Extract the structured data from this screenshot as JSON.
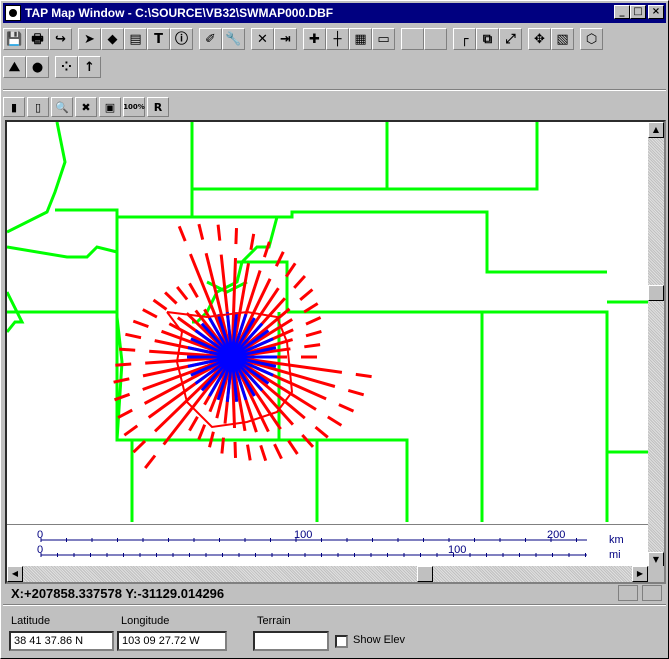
{
  "window": {
    "title": "TAP Map Window - C:\\SOURCE\\VB32\\SWMAP000.DBF",
    "minimize": "_",
    "maximize": "□",
    "close": "×"
  },
  "toolbar1": [
    {
      "name": "save-icon",
      "glyph": "💾"
    },
    {
      "name": "print-icon",
      "glyph": "🖶"
    },
    {
      "name": "redo-icon",
      "glyph": "↪"
    },
    {
      "name": "pointer-icon",
      "glyph": "➤"
    },
    {
      "name": "select-region-icon",
      "glyph": "◆"
    },
    {
      "name": "layer-icon",
      "glyph": "▤"
    },
    {
      "name": "text-icon",
      "glyph": "T"
    },
    {
      "name": "info-icon",
      "glyph": "ⓘ"
    },
    {
      "name": "draw-line-icon",
      "glyph": "✐"
    },
    {
      "name": "wrench-icon",
      "glyph": "🔧"
    },
    {
      "name": "delete-icon",
      "glyph": "✕"
    },
    {
      "name": "exit-icon",
      "glyph": "⇥"
    },
    {
      "name": "add-point-icon",
      "glyph": "✚"
    },
    {
      "name": "ruler-icon",
      "glyph": "┼"
    },
    {
      "name": "grid-icon",
      "glyph": "▦"
    },
    {
      "name": "document-icon",
      "glyph": "▭"
    },
    {
      "name": "blank-button-1",
      "glyph": ""
    },
    {
      "name": "blank-button-2",
      "glyph": ""
    },
    {
      "name": "corner-icon",
      "glyph": "┌"
    },
    {
      "name": "zoom-box-icon",
      "glyph": "⧉"
    },
    {
      "name": "expand-icon",
      "glyph": "⤢"
    },
    {
      "name": "pan-icon",
      "glyph": "✥"
    },
    {
      "name": "colors-icon",
      "glyph": "▧"
    },
    {
      "name": "polygon-icon",
      "glyph": "⬡"
    }
  ],
  "toolbar2": [
    {
      "name": "terrain-profile-icon",
      "glyph": "⛰"
    },
    {
      "name": "globe-icon",
      "glyph": "●"
    },
    {
      "name": "points-icon",
      "glyph": "⁘"
    },
    {
      "name": "arrow-up-icon",
      "glyph": "↑"
    }
  ],
  "toolbar3": [
    {
      "name": "map-icon",
      "glyph": "▮"
    },
    {
      "name": "small-map-icon",
      "glyph": "▯"
    },
    {
      "name": "zoom-icon",
      "glyph": "🔍"
    },
    {
      "name": "cancel-icon",
      "glyph": "✖"
    },
    {
      "name": "picture-icon",
      "glyph": "▣"
    },
    {
      "name": "zoom-100-icon",
      "glyph": "100%"
    },
    {
      "name": "radius-icon",
      "glyph": "R"
    }
  ],
  "scale": {
    "km_label": "km",
    "mi_label": "mi",
    "km_zero": "0",
    "km_mid": "100",
    "km_end": "200",
    "mi_zero": "0",
    "mi_mid": "100"
  },
  "status": {
    "coordinates": "X:+207858.337578 Y:-31129.014296"
  },
  "fields": {
    "latitude_label": "Latitude",
    "latitude_value": "38 41 37.86 N",
    "longitude_label": "Longitude",
    "longitude_value": "103 09 27.72 W",
    "terrain_label": "Terrain",
    "terrain_value": "",
    "show_elev_label": "Show Elev"
  },
  "colors": {
    "boundary": "#00ff00",
    "radial": "#ff0000",
    "coverage": "#0000ff",
    "title_bar": "#000080"
  }
}
